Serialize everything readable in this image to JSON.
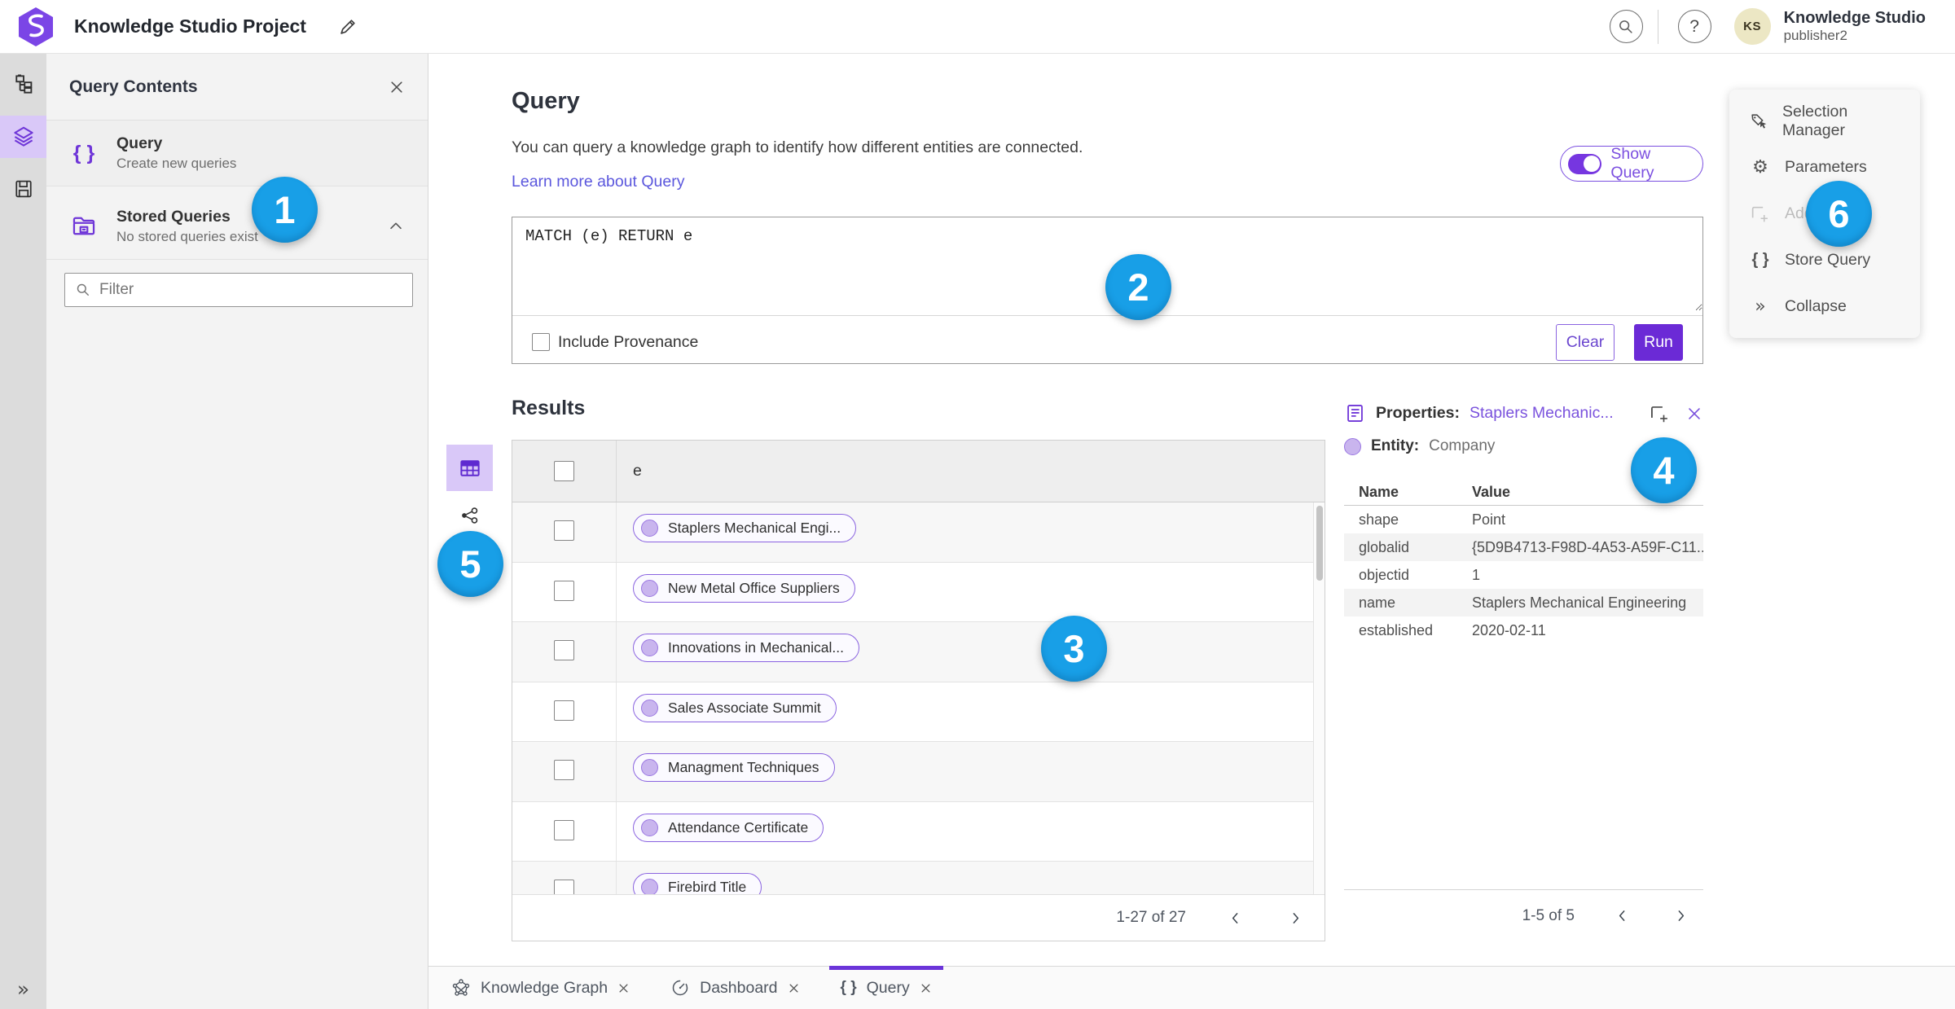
{
  "topbar": {
    "title": "Knowledge Studio Project",
    "help_glyph": "?",
    "user": {
      "initials": "KS",
      "org": "Knowledge Studio",
      "name": "publisher2"
    }
  },
  "contents": {
    "title": "Query Contents",
    "query_item": {
      "title": "Query",
      "subtitle": "Create new queries"
    },
    "stored_item": {
      "title": "Stored Queries",
      "subtitle": "No stored queries exist"
    },
    "filter_placeholder": "Filter"
  },
  "query": {
    "heading": "Query",
    "description": "You can query a knowledge graph to identify how different entities are connected.",
    "link": "Learn more about Query",
    "show_query": "Show Query",
    "text": "MATCH (e) RETURN e",
    "include_provenance": "Include Provenance",
    "clear": "Clear",
    "run": "Run"
  },
  "results": {
    "heading": "Results",
    "column": "e",
    "rows": [
      "Staplers Mechanical Engi...",
      "New Metal Office Suppliers",
      "Innovations in Mechanical...",
      "Sales Associate Summit",
      "Managment Techniques",
      "Attendance Certificate",
      "Firebird Title"
    ],
    "pagination": {
      "range": "1-27 of 27"
    }
  },
  "properties": {
    "label": "Properties:",
    "name": "Staplers Mechanic...",
    "entity_label": "Entity:",
    "entity_type": "Company",
    "col_name": "Name",
    "col_value": "Value",
    "rows": [
      [
        "shape",
        "Point"
      ],
      [
        "globalid",
        "{5D9B4713-F98D-4A53-A59F-C11..."
      ],
      [
        "objectid",
        "1"
      ],
      [
        "name",
        "Staplers Mechanical Engineering"
      ],
      [
        "established",
        "2020-02-11"
      ]
    ],
    "pagination": {
      "range": "1-5 of 5"
    }
  },
  "tools": {
    "items": [
      "Selection Manager",
      "Parameters",
      "Add",
      "Store Query",
      "Collapse"
    ]
  },
  "tabs": {
    "items": [
      {
        "label": "Knowledge Graph"
      },
      {
        "label": "Dashboard"
      },
      {
        "label": "Query"
      }
    ]
  },
  "annotations": {
    "numbers": [
      "1",
      "2",
      "3",
      "4",
      "5",
      "6"
    ]
  },
  "icons": {
    "search": "magnifier",
    "help": "question-circle",
    "edit": "pencil",
    "close": "×",
    "chevron_up": "^",
    "chevron_left": "‹",
    "chevron_right": "›",
    "braces": "{ }",
    "gear": "⚙",
    "collapse": "»",
    "expand": "»",
    "table_view": "grid-table",
    "graph_view": "share-nodes",
    "hierarchy": "org-chart",
    "layers": "layer-stack",
    "save": "floppy-disk",
    "stored_queries": "folder-archive",
    "properties": "form-lines",
    "add_to_selection": "square-plus",
    "selection_manager": "tag-cursor",
    "knowledge_graph_tab": "node-graph",
    "dashboard_tab": "gauge"
  },
  "colors": {
    "accent_purple": "#6b2ad6",
    "purple_text": "#7a52dd",
    "light_purple": "#d9c8f8",
    "pill_border": "#8a63e0",
    "pill_dot": "#c9b5ee",
    "link": "#5b57dd",
    "annotation_blue": "#189fe7",
    "rail_bg": "#dcdcdc",
    "panel_bg": "#f3f3f3",
    "header_gray": "#eeeeee",
    "avatar_bg": "#ece7c4"
  }
}
